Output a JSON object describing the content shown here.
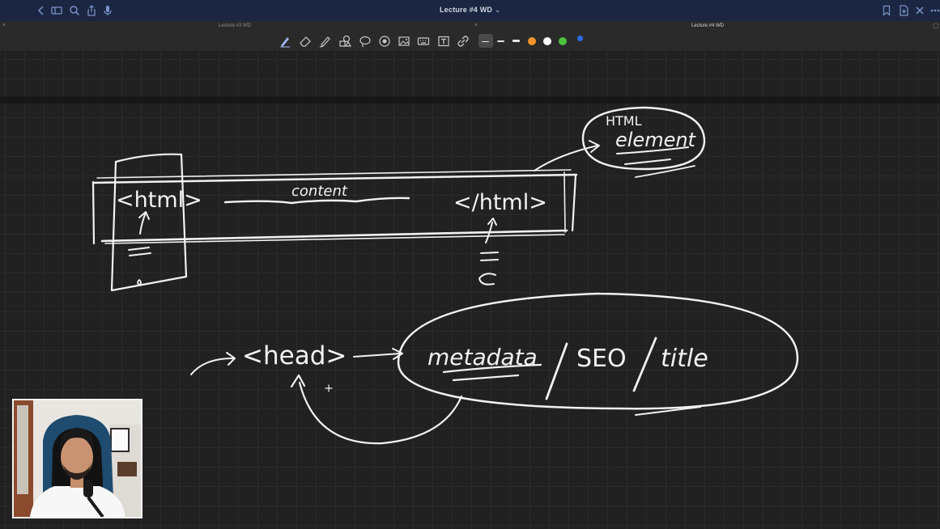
{
  "window": {
    "title": "Lecture #4 WD",
    "title_menu_icon": "chevron-down-icon",
    "background": "#1b2742"
  },
  "titlebar_left_icons": [
    "back-icon",
    "sidebar-icon",
    "search-icon",
    "share-icon",
    "microphone-icon"
  ],
  "titlebar_right_icons": [
    "bookmark-icon",
    "new-page-icon",
    "close-icon",
    "more-icon"
  ],
  "tabs": [
    {
      "label": "Lecture #3 WD",
      "active": false
    },
    {
      "label": "Lecture #4 WD",
      "active": true
    }
  ],
  "toolbar": {
    "tools": [
      "pen-icon",
      "eraser-icon",
      "highlighter-icon",
      "shapes-icon",
      "lasso-icon",
      "laser-pointer-icon",
      "image-icon",
      "keyboard-icon",
      "text-box-icon",
      "link-icon"
    ],
    "stroke_widths": [
      "thin-stroke",
      "medium-stroke",
      "thick-stroke"
    ],
    "colors": [
      "#f0952b",
      "#ffffff",
      "#4cc23e",
      "#2b6de8"
    ]
  },
  "notes": {
    "html_element_label": [
      "HTML",
      "element"
    ],
    "open_tag": "<html>",
    "content": "content",
    "close_tag": "</html>",
    "head_tag": "<head>",
    "head_description": [
      "metadata",
      "SEO",
      "title"
    ]
  },
  "webcam": {
    "label": "presenter-webcam"
  }
}
